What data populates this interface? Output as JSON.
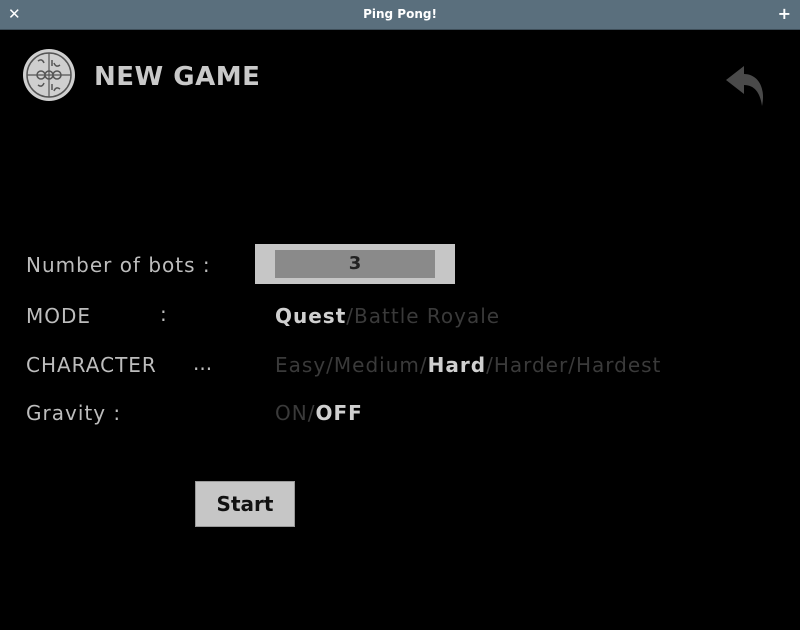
{
  "window": {
    "title": "Ping Pong!",
    "close_icon": "close-icon",
    "maximize_icon": "maximize-icon"
  },
  "header": {
    "title": "NEW GAME",
    "logo_icon": "logo-icon",
    "back_icon": "back-arrow-icon"
  },
  "settings": {
    "bots": {
      "label": "Number of bots :",
      "value": "3"
    },
    "mode": {
      "label": "MODE",
      "separator": ":",
      "options": [
        "Quest",
        "Battle Royale"
      ],
      "selected": "Quest"
    },
    "character": {
      "label": "CHARACTER",
      "separator": "...",
      "options": [
        "Easy",
        "Medium",
        "Hard",
        "Harder",
        "Hardest"
      ],
      "selected": "Hard"
    },
    "gravity": {
      "label": "Gravity :",
      "options": [
        "ON",
        "OFF"
      ],
      "selected": "OFF"
    }
  },
  "start_label": "Start",
  "colors": {
    "titlebar": "#5a6f7d",
    "background": "#000000",
    "active_text": "#d0d0d0",
    "inactive_text": "#3a3a3a",
    "button": "#c6c6c6"
  }
}
